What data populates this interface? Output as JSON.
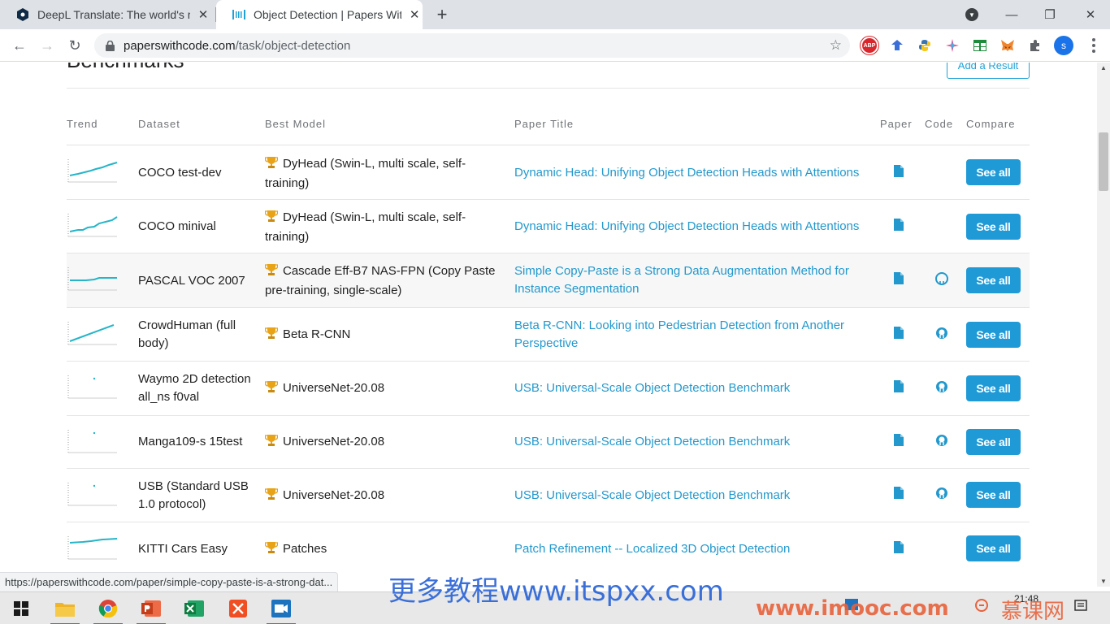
{
  "browser": {
    "tabs": [
      {
        "title": "DeepL Translate: The world's m",
        "active": false
      },
      {
        "title": "Object Detection | Papers With",
        "active": true
      }
    ],
    "new_tab_label": "+",
    "url_host": "paperswithcode.com",
    "url_path": "/task/object-detection",
    "profile_initial": "s",
    "extension_abp": "ABP"
  },
  "page": {
    "section_title": "Benchmarks",
    "add_result_label": "Add a Result",
    "columns": {
      "trend": "Trend",
      "dataset": "Dataset",
      "best_model": "Best Model",
      "paper_title": "Paper Title",
      "paper": "Paper",
      "code": "Code",
      "compare": "Compare"
    },
    "rows": [
      {
        "dataset": "COCO test-dev",
        "model": "DyHead (Swin-L, multi scale, self-training)",
        "paper_title": "Dynamic Head: Unifying Object Detection Heads with Attentions",
        "has_code": false,
        "compare": "See all"
      },
      {
        "dataset": "COCO minival",
        "model": "DyHead (Swin-L, multi scale, self-training)",
        "paper_title": "Dynamic Head: Unifying Object Detection Heads with Attentions",
        "has_code": false,
        "compare": "See all"
      },
      {
        "dataset": "PASCAL VOC 2007",
        "model": "Cascade Eff-B7 NAS-FPN (Copy Paste pre-training, single-scale)",
        "paper_title": "Simple Copy-Paste is a Strong Data Augmentation Method for Instance Segmentation",
        "has_code": true,
        "compare": "See all"
      },
      {
        "dataset": "CrowdHuman (full body)",
        "model": "Beta R-CNN",
        "paper_title": "Beta R-CNN: Looking into Pedestrian Detection from Another Perspective",
        "has_code": true,
        "compare": "See all"
      },
      {
        "dataset": "Waymo 2D detection all_ns f0val",
        "model": "UniverseNet-20.08",
        "paper_title": "USB: Universal-Scale Object Detection Benchmark",
        "has_code": true,
        "compare": "See all"
      },
      {
        "dataset": "Manga109-s 15test",
        "model": "UniverseNet-20.08",
        "paper_title": "USB: Universal-Scale Object Detection Benchmark",
        "has_code": true,
        "compare": "See all"
      },
      {
        "dataset": "USB (Standard USB 1.0 protocol)",
        "model": "UniverseNet-20.08",
        "paper_title": "USB: Universal-Scale Object Detection Benchmark",
        "has_code": true,
        "compare": "See all"
      },
      {
        "dataset": "KITTI Cars Easy",
        "model": "Patches",
        "paper_title": "Patch Refinement -- Localized 3D Object Detection",
        "has_code": false,
        "compare": "See all"
      }
    ]
  },
  "status_url": "https://paperswithcode.com/paper/simple-copy-paste-is-a-strong-dat...",
  "watermark_text": "更多教程www.itspxx.com",
  "watermark_imooc": "www.imooc.com",
  "watermark_brand": "慕课网",
  "clock_time": "21:48",
  "colors": {
    "accent": "#1f9ad6",
    "link": "#2398cc",
    "trend_line": "#25b5c8"
  }
}
